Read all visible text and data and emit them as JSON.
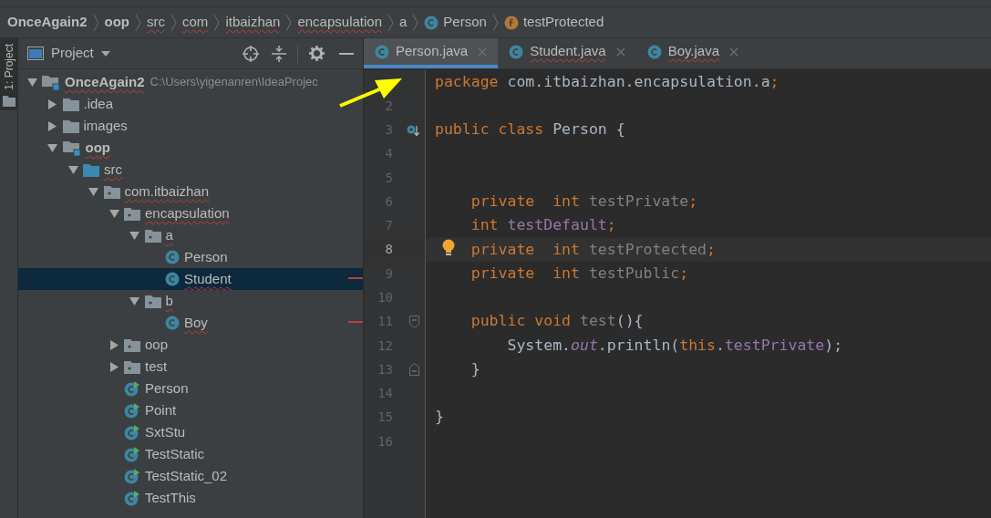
{
  "breadcrumbs": [
    {
      "label": "OnceAgain2",
      "kind": "module",
      "bold": true,
      "misspelled": false
    },
    {
      "label": "oop",
      "kind": "module",
      "bold": true,
      "misspelled": false
    },
    {
      "label": "src",
      "kind": "folder",
      "bold": false,
      "misspelled": true
    },
    {
      "label": "com",
      "kind": "package",
      "bold": false,
      "misspelled": true
    },
    {
      "label": "itbaizhan",
      "kind": "package",
      "bold": false,
      "misspelled": true
    },
    {
      "label": "encapsulation",
      "kind": "package",
      "bold": false,
      "misspelled": true
    },
    {
      "label": "a",
      "kind": "package",
      "bold": false,
      "misspelled": false
    },
    {
      "label": "Person",
      "kind": "class",
      "bold": false,
      "misspelled": false
    },
    {
      "label": "testProtected",
      "kind": "field",
      "bold": false,
      "misspelled": false
    }
  ],
  "side_strip": {
    "tab": {
      "label": "1: Project",
      "selected": true
    }
  },
  "project_panel": {
    "title": "Project",
    "tree": [
      {
        "label": "OnceAgain2",
        "kind": "module",
        "bold": true,
        "misspelled": true,
        "hint": "C:\\Users\\yigenanren\\IdeaProjec",
        "expanded": true,
        "selected": false,
        "children": [
          {
            "label": ".idea",
            "kind": "folder",
            "bold": false,
            "misspelled": false,
            "expanded": false,
            "selected": false
          },
          {
            "label": "images",
            "kind": "folder",
            "bold": false,
            "misspelled": false,
            "expanded": false,
            "selected": false
          },
          {
            "label": "oop",
            "kind": "module",
            "bold": true,
            "misspelled": true,
            "expanded": true,
            "selected": false,
            "children": [
              {
                "label": "src",
                "kind": "source_root",
                "bold": false,
                "misspelled": true,
                "expanded": true,
                "selected": false,
                "children": [
                  {
                    "label": "com.itbaizhan",
                    "kind": "package",
                    "bold": false,
                    "misspelled": true,
                    "expanded": true,
                    "selected": false,
                    "children": [
                      {
                        "label": "encapsulation",
                        "kind": "package",
                        "bold": false,
                        "misspelled": true,
                        "expanded": true,
                        "selected": false,
                        "children": [
                          {
                            "label": "a",
                            "kind": "package",
                            "bold": false,
                            "misspelled": true,
                            "expanded": true,
                            "selected": false,
                            "children": [
                              {
                                "label": "Person",
                                "kind": "class",
                                "bold": false,
                                "misspelled": false,
                                "selected": false,
                                "error_mark": false
                              },
                              {
                                "label": "Student",
                                "kind": "class",
                                "bold": false,
                                "misspelled": true,
                                "selected": true,
                                "error_mark": true
                              }
                            ]
                          },
                          {
                            "label": "b",
                            "kind": "package",
                            "bold": false,
                            "misspelled": true,
                            "expanded": true,
                            "selected": false,
                            "children": [
                              {
                                "label": "Boy",
                                "kind": "class",
                                "bold": false,
                                "misspelled": true,
                                "selected": false,
                                "error_mark": true
                              }
                            ]
                          }
                        ]
                      },
                      {
                        "label": "oop",
                        "kind": "package",
                        "bold": false,
                        "misspelled": false,
                        "expanded": false,
                        "selected": false
                      },
                      {
                        "label": "test",
                        "kind": "package",
                        "bold": false,
                        "misspelled": false,
                        "expanded": false,
                        "selected": false
                      },
                      {
                        "label": "Person",
                        "kind": "main_class",
                        "bold": false,
                        "misspelled": false,
                        "selected": false
                      },
                      {
                        "label": "Point",
                        "kind": "main_class",
                        "bold": false,
                        "misspelled": false,
                        "selected": false
                      },
                      {
                        "label": "SxtStu",
                        "kind": "main_class",
                        "bold": false,
                        "misspelled": false,
                        "selected": false
                      },
                      {
                        "label": "TestStatic",
                        "kind": "main_class",
                        "bold": false,
                        "misspelled": false,
                        "selected": false
                      },
                      {
                        "label": "TestStatic_02",
                        "kind": "main_class",
                        "bold": false,
                        "misspelled": false,
                        "selected": false
                      },
                      {
                        "label": "TestThis",
                        "kind": "main_class",
                        "bold": false,
                        "misspelled": false,
                        "selected": false
                      }
                    ]
                  }
                ]
              }
            ]
          }
        ]
      }
    ]
  },
  "editor_tabs": [
    {
      "label": "Person.java",
      "selected": true,
      "misspelled": false
    },
    {
      "label": "Student.java",
      "selected": false,
      "misspelled": true
    },
    {
      "label": "Boy.java",
      "selected": false,
      "misspelled": true
    }
  ],
  "code_lines": [
    {
      "kind": "plain",
      "tokens": [
        {
          "kind": "keyword",
          "text": "package "
        },
        {
          "kind": "plain",
          "text": "com.itbaizhan.encapsulation.a"
        },
        {
          "kind": "keyword",
          "text": ";"
        }
      ]
    },
    {
      "number": "2",
      "kind": "plain",
      "current": false
    },
    {
      "number": "3",
      "current": false,
      "kind": "implemented",
      "tokens": [
        {
          "kind": "keyword",
          "text": "public class "
        },
        {
          "kind": "plain",
          "text": "Person {"
        }
      ]
    },
    {
      "number": "4",
      "kind": "plain",
      "current": false
    },
    {
      "number": "5",
      "kind": "plain",
      "current": false
    },
    {
      "number": "6",
      "kind": "plain",
      "current": false,
      "tokens": [
        {
          "kind": "keyword",
          "text": "    private  int "
        },
        {
          "kind": "unused",
          "text": "testPrivate"
        },
        {
          "kind": "keyword",
          "text": ";"
        }
      ]
    },
    {
      "number": "7",
      "kind": "plain",
      "current": false,
      "tokens": [
        {
          "kind": "keyword",
          "text": "    int "
        },
        {
          "kind": "field",
          "text": "testDefault"
        },
        {
          "kind": "keyword",
          "text": ";"
        }
      ]
    },
    {
      "number": "8",
      "current": true,
      "kind": "bulb",
      "tokens": [
        {
          "kind": "keyword",
          "text": "    private  int "
        },
        {
          "kind": "unused",
          "text": "testProtected"
        },
        {
          "kind": "keyword",
          "text": ";"
        }
      ]
    },
    {
      "number": "9",
      "kind": "plain",
      "current": false,
      "tokens": [
        {
          "kind": "keyword",
          "text": "    private  int "
        },
        {
          "kind": "unused",
          "text": "testPublic"
        },
        {
          "kind": "keyword",
          "text": ";"
        }
      ]
    },
    {
      "number": "10",
      "kind": "plain",
      "current": false
    },
    {
      "number": "11",
      "current": false,
      "kind": "fold_start",
      "tokens": [
        {
          "kind": "keyword",
          "text": "    public void "
        },
        {
          "kind": "unused",
          "text": "test"
        },
        {
          "kind": "plain",
          "text": "(){"
        }
      ]
    },
    {
      "number": "12",
      "kind": "plain",
      "current": false,
      "tokens": [
        {
          "kind": "plain",
          "text": "        System."
        },
        {
          "kind": "static_field",
          "text": "out"
        },
        {
          "kind": "plain",
          "text": ".println("
        },
        {
          "kind": "keyword",
          "text": "this"
        },
        {
          "kind": "plain",
          "text": "."
        },
        {
          "kind": "field",
          "text": "testPrivate"
        },
        {
          "kind": "plain",
          "text": ");"
        }
      ]
    },
    {
      "number": "13",
      "current": false,
      "kind": "fold_end",
      "tokens": [
        {
          "kind": "plain",
          "text": "    }"
        }
      ]
    },
    {
      "number": "14",
      "kind": "plain",
      "current": false
    },
    {
      "number": "15",
      "kind": "plain",
      "current": false,
      "tokens": [
        {
          "kind": "plain",
          "text": "}"
        }
      ]
    },
    {
      "number": "16",
      "kind": "plain",
      "current": false
    }
  ]
}
